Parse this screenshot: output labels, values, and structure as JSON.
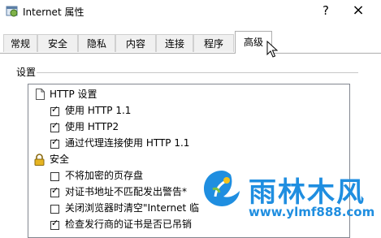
{
  "window": {
    "title": "Internet 属性",
    "help": "?",
    "close": "×"
  },
  "tabs": [
    {
      "label": "常规",
      "active": false
    },
    {
      "label": "安全",
      "active": false
    },
    {
      "label": "隐私",
      "active": false
    },
    {
      "label": "内容",
      "active": false
    },
    {
      "label": "连接",
      "active": false
    },
    {
      "label": "程序",
      "active": false
    },
    {
      "label": "高级",
      "active": true
    }
  ],
  "settings": {
    "group_label": "设置",
    "items": [
      {
        "type": "header",
        "icon": "document-icon",
        "label": "HTTP 设置"
      },
      {
        "type": "checkbox",
        "checked": true,
        "label": "使用 HTTP 1.1"
      },
      {
        "type": "checkbox",
        "checked": true,
        "label": "使用 HTTP2"
      },
      {
        "type": "checkbox",
        "checked": true,
        "label": "通过代理连接使用 HTTP 1.1"
      },
      {
        "type": "header",
        "icon": "lock-icon",
        "label": "安全"
      },
      {
        "type": "checkbox",
        "checked": false,
        "label": "不将加密的页存盘"
      },
      {
        "type": "checkbox",
        "checked": true,
        "label": "对证书地址不匹配发出警告*"
      },
      {
        "type": "checkbox",
        "checked": false,
        "label": "关闭浏览器时清空\"Internet 临"
      },
      {
        "type": "checkbox",
        "checked": true,
        "label": "检查发行商的证书是否已吊销"
      }
    ]
  },
  "watermark": {
    "text": "雨林木风",
    "url": "www.ylmf888.com",
    "color": "#1f8ee0"
  }
}
